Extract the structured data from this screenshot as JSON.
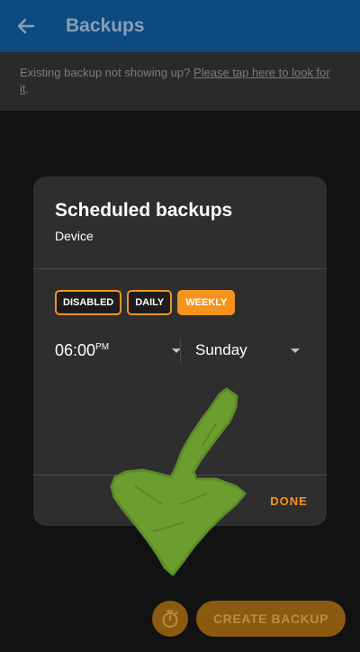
{
  "appbar": {
    "title": "Backups",
    "back_icon": "arrow-left-icon"
  },
  "banner": {
    "text": "Existing backup not showing up? ",
    "link": "Please tap here to look for it",
    "tail": "."
  },
  "dialog": {
    "title": "Scheduled backups",
    "subtitle": "Device",
    "frequency_options": [
      "DISABLED",
      "DAILY",
      "WEEKLY"
    ],
    "selected_frequency": "WEEKLY",
    "time": {
      "value": "06:00",
      "suffix": "PM"
    },
    "day": "Sunday",
    "done_label": "DONE"
  },
  "bottom": {
    "create_label": "CREATE BACKUP",
    "timer_icon": "timer-icon"
  },
  "colors": {
    "accent": "#f5931e",
    "appbar": "#0c4a80",
    "annotation_arrow": "#6b9e2f"
  }
}
